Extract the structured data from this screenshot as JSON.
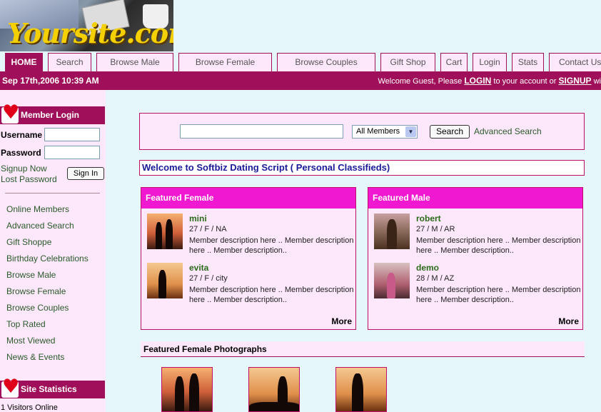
{
  "logo": {
    "text": "Yoursite.com"
  },
  "nav": {
    "tabs": [
      {
        "label": "HOME",
        "active": true
      },
      {
        "label": "Search"
      },
      {
        "label": "Browse Male"
      },
      {
        "label": "Browse Female"
      },
      {
        "label": "Browse Couples"
      },
      {
        "label": "Gift Shop"
      },
      {
        "label": "Cart"
      },
      {
        "label": "Login"
      },
      {
        "label": "Stats"
      },
      {
        "label": "Contact Us"
      }
    ]
  },
  "bar": {
    "date": "Sep 17th,2006 10:39 AM",
    "welcome_prefix": "Welcome Guest, Please",
    "login": "LOGIN",
    "mid": "to your account or",
    "signup": "SIGNUP",
    "suffix": "wi"
  },
  "login_box": {
    "title": "Member Login",
    "username_label": "Username",
    "password_label": "Password",
    "signup_now": "Signup Now",
    "lost_password": "Lost Password",
    "signin": "Sign In"
  },
  "menu": [
    "Online Members",
    "Advanced Search",
    "Gift Shoppe",
    "Birthday Celebrations",
    "Browse Male",
    "Browse Female",
    "Browse Couples",
    "Top Rated",
    "Most Viewed",
    "News & Events"
  ],
  "stats_box": {
    "title": "Site Statistics",
    "visitors": "1 Visitors Online"
  },
  "search": {
    "value": "",
    "select_value": "All Members",
    "button": "Search",
    "advanced": "Advanced Search"
  },
  "welcome_title": "Welcome to Softbiz Dating Script ( Personal Classifieds)",
  "featured_female": {
    "title": "Featured Female",
    "more": "More",
    "members": [
      {
        "name": "mini",
        "info": "27 / F / NA",
        "desc": "Member description here .. Member description here .. Member description.."
      },
      {
        "name": "evita",
        "info": "27 / F / city",
        "desc": "Member description here .. Member description here .. Member description.."
      }
    ]
  },
  "featured_male": {
    "title": "Featured Male",
    "more": "More",
    "members": [
      {
        "name": "robert",
        "info": "27 / M / AR",
        "desc": "Member description here .. Member description here .. Member description.."
      },
      {
        "name": "demo",
        "info": "28 / M / AZ",
        "desc": "Member description here .. Member description here .. Member description.."
      }
    ]
  },
  "photos": {
    "title": "Featured Female Photographs"
  },
  "colors": {
    "brand": "#a0105a",
    "feature_header": "#f018d0",
    "panel": "#fde7fb",
    "background": "#e6f7fb",
    "link": "#2a5a2a"
  }
}
